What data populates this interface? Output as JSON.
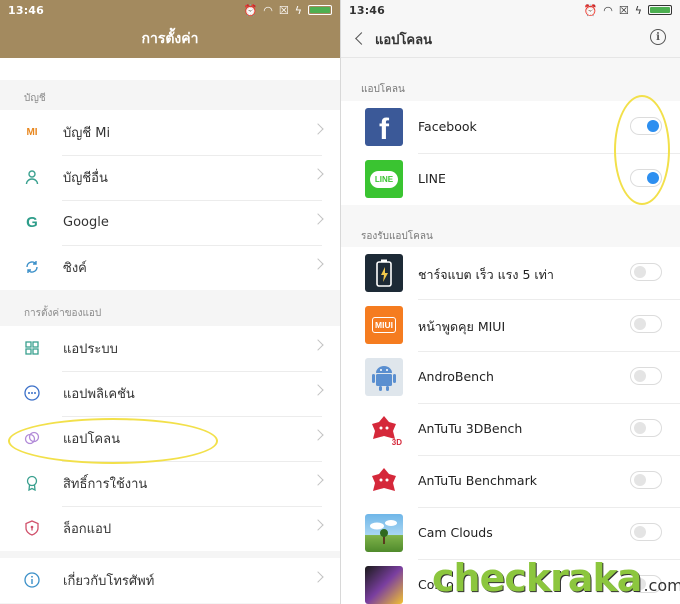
{
  "status_bar": {
    "time": "13:46"
  },
  "left": {
    "title": "การตั้งค่า",
    "section_accounts": "บัญชี",
    "accounts": [
      {
        "label": "บัญชี Mi",
        "icon": "mi-icon"
      },
      {
        "label": "บัญชีอื่น",
        "icon": "person-icon"
      },
      {
        "label": "Google",
        "icon": "google-icon"
      },
      {
        "label": "ซิงค์",
        "icon": "sync-icon"
      }
    ],
    "section_app_settings": "การตั้งค่าของแอป",
    "app_settings": [
      {
        "label": "แอประบบ",
        "icon": "grid-icon"
      },
      {
        "label": "แอปพลิเคชัน",
        "icon": "dots-icon"
      },
      {
        "label": "แอปโคลน",
        "icon": "clone-icon"
      },
      {
        "label": "สิทธิ์การใช้งาน",
        "icon": "permission-icon"
      },
      {
        "label": "ล็อกแอป",
        "icon": "lock-shield-icon"
      }
    ],
    "about": {
      "label": "เกี่ยวกับโทรศัพท์",
      "icon": "info-icon"
    }
  },
  "right": {
    "title": "แอปโคลน",
    "section_cloned": "แอปโคลน",
    "cloned_apps": [
      {
        "name": "Facebook",
        "enabled": true
      },
      {
        "name": "LINE",
        "enabled": true
      }
    ],
    "section_supported": "รองรับแอปโคลน",
    "supported_apps": [
      {
        "name": "ชาร์จแบต เร็ว แรง 5 เท่า",
        "enabled": false
      },
      {
        "name": "หน้าพูดคุย MIUI",
        "enabled": false
      },
      {
        "name": "AndroBench",
        "enabled": false
      },
      {
        "name": "AnTuTu 3DBench",
        "enabled": false
      },
      {
        "name": "AnTuTu Benchmark",
        "enabled": false
      },
      {
        "name": "Cam Clouds",
        "enabled": false
      },
      {
        "name": "Co...o",
        "enabled": false
      }
    ]
  },
  "icon_text": {
    "mi": "MI",
    "google": "G",
    "facebook": "f",
    "line": "LINE",
    "miui": "MIUI",
    "antutu_3d": "3D",
    "info": "i"
  },
  "watermark": {
    "main": "checkraka",
    "domain": ".com"
  },
  "colors": {
    "header_gold": "#a38a5f",
    "toggle_on": "#2d8ff0",
    "highlight_yellow": "#f2e04a",
    "facebook": "#3b5998",
    "line": "#3ac431",
    "miui": "#f57c20"
  }
}
